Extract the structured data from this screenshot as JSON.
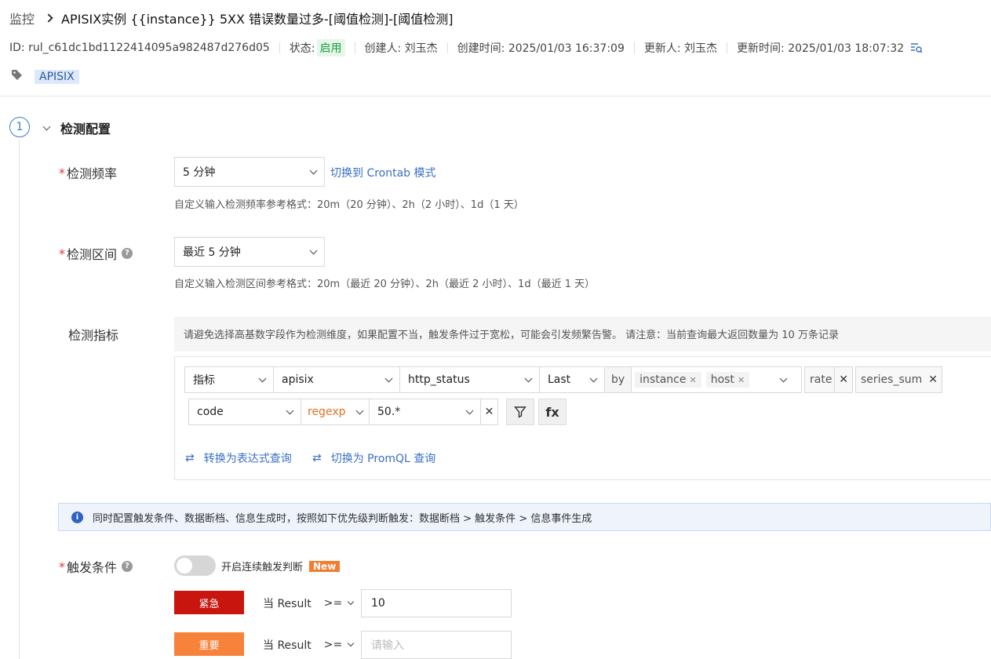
{
  "breadcrumb": {
    "root": "监控",
    "title": "APISIX实例 {{instance}} 5XX 错误数量过多-[阈值检测]-[阈值检测]"
  },
  "meta": {
    "id": "ID: rul_c61dc1bd1122414095a982487d276d05",
    "status_label": "状态:",
    "status_value": "启用",
    "creator": "创建人: 刘玉杰",
    "created_at": "创建时间: 2025/01/03 16:37:09",
    "updater": "更新人: 刘玉杰",
    "updated_at": "更新时间: 2025/01/03 18:07:32"
  },
  "tags": [
    "APISIX"
  ],
  "step": {
    "number": "1",
    "title": "检测配置"
  },
  "frequency": {
    "label": "检测频率",
    "value": "5 分钟",
    "switch_link": "切换到 Crontab 模式",
    "hint": "自定义输入检测频率参考格式：20m（20 分钟）、2h（2 小时）、1d（1 天）"
  },
  "interval": {
    "label": "检测区间",
    "value": "最近 5 分钟",
    "hint": "自定义输入检测区间参考格式：20m（最近 20 分钟）、2h（最近 2 小时）、1d（最近 1 天）"
  },
  "metric": {
    "label": "检测指标",
    "notice": "请避免选择高基数字段作为检测维度，如果配置不当，触发条件过于宽松，可能会引发频繁告警。 请注意：当前查询最大返回数量为 10 万条记录",
    "type": "指标",
    "source": "apisix",
    "field": "http_status",
    "agg": "Last",
    "by_label": "by",
    "group_by": [
      "instance",
      "host"
    ],
    "funcs": [
      "rate",
      "series_sum"
    ],
    "filter_field": "code",
    "filter_op": "regexp",
    "filter_value": "50.*",
    "fx_label": "fx",
    "switch_expr": "转换为表达式查询",
    "switch_promql": "切换为 PromQL 查询"
  },
  "info_banner": "同时配置触发条件、数据断档、信息生成时，按照如下优先级判断触发：数据断档 > 触发条件 > 信息事件生成",
  "trigger": {
    "label": "触发条件",
    "toggle_label": "开启连续触发判断",
    "new_badge": "New",
    "rows": [
      {
        "level": "紧急",
        "color": "#c8160f",
        "prefix": "当 Result",
        "op": ">=",
        "value": "10",
        "placeholder": ""
      },
      {
        "level": "重要",
        "color": "#f7833b",
        "prefix": "当 Result",
        "op": ">=",
        "value": "",
        "placeholder": "请输入"
      }
    ]
  }
}
